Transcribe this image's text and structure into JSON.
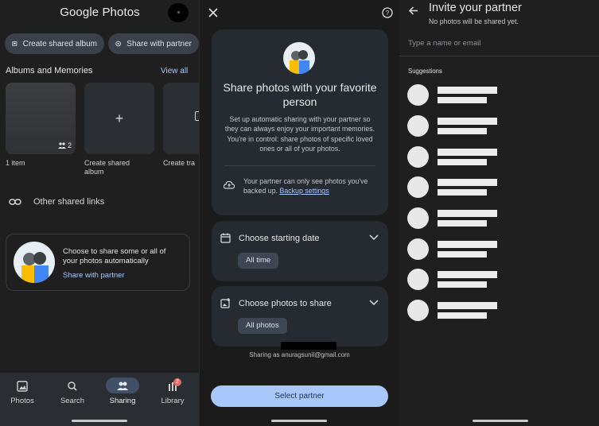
{
  "panel1": {
    "app_title": "Google Photos",
    "chips": {
      "create_album": "Create shared album",
      "share_partner": "Share with partner"
    },
    "section_title": "Albums and Memories",
    "view_all": "View all",
    "tiles": [
      {
        "label": "1 item",
        "badge": "2"
      },
      {
        "label": "Create shared album",
        "icon": "plus-icon"
      },
      {
        "label": "Create tra"
      }
    ],
    "other_links": "Other shared links",
    "promo": {
      "text": "Choose to share some or all of your photos automatically",
      "link": "Share with partner"
    },
    "nav": [
      {
        "label": "Photos",
        "icon": "photo-icon"
      },
      {
        "label": "Search",
        "icon": "search-icon"
      },
      {
        "label": "Sharing",
        "icon": "people-icon",
        "active": true
      },
      {
        "label": "Library",
        "icon": "library-icon",
        "badge": "2"
      }
    ]
  },
  "panel2": {
    "title": "Share photos with your favorite person",
    "description": "Set up automatic sharing with your partner so they can always enjoy your important memories. You're in control: share photos of specific loved ones or all of your photos.",
    "backup_note": "Your partner can only see photos you've backed up.",
    "backup_link": "Backup settings",
    "date_section": {
      "label": "Choose starting date",
      "value": "All time"
    },
    "photos_section": {
      "label": "Choose photos to share",
      "value": "All photos"
    },
    "sharing_as": "Sharing as anuragsunil@gmail.com",
    "button": "Select partner"
  },
  "panel3": {
    "title": "Invite your partner",
    "subtitle": "No photos will be shared yet.",
    "input_placeholder": "Type a name or email",
    "suggestions_label": "Suggestions"
  },
  "colors": {
    "accent": "#a8c7fa",
    "background": "#1f1f1f",
    "card": "#262b31"
  }
}
